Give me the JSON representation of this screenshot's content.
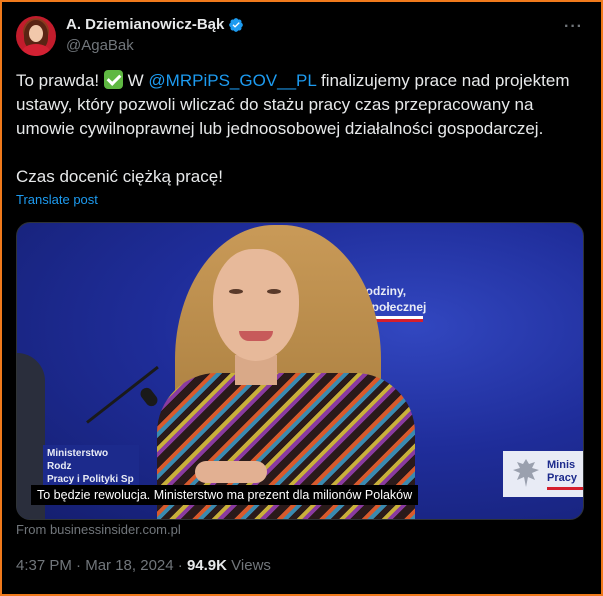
{
  "author": {
    "display_name": "A. Dziemianowicz-Bąk",
    "handle": "@AgaBak",
    "verified": true
  },
  "more_icon": "ellipsis-icon",
  "post": {
    "line1_before_mention": "To prawda!",
    "line1_w": "W",
    "mention": "@MRPiPS_GOV__PL",
    "line1_after_mention": "finalizujemy prace nad projektem ustawy, który pozwoli wliczać do stażu pracy czas przepracowany na umowie cywilnoprawnej lub jednoosobowej działalności gospodarczej.",
    "line2": "Czas docenić ciężką pracę!"
  },
  "translate_label": "Translate post",
  "card": {
    "wall_text_1": "strstwo Rodziny,",
    "wall_text_2": "i Polityki Społecznej",
    "plaque_left_1": "Ministerstwo Rodz",
    "plaque_left_2": "Pracy i Polityki Sp",
    "plaque_right_1": "Minis",
    "plaque_right_2": "Pracy",
    "caption": "To będzie rewolucja. Ministerstwo ma prezent dla milionów Polaków",
    "source": "From businessinsider.com.pl"
  },
  "meta": {
    "time": "4:37 PM",
    "date": "Mar 18, 2024",
    "views_count": "94.9K",
    "views_label": "Views"
  },
  "colors": {
    "accent": "#1d9bf0",
    "border": "#f07a1c",
    "background": "#000000"
  }
}
